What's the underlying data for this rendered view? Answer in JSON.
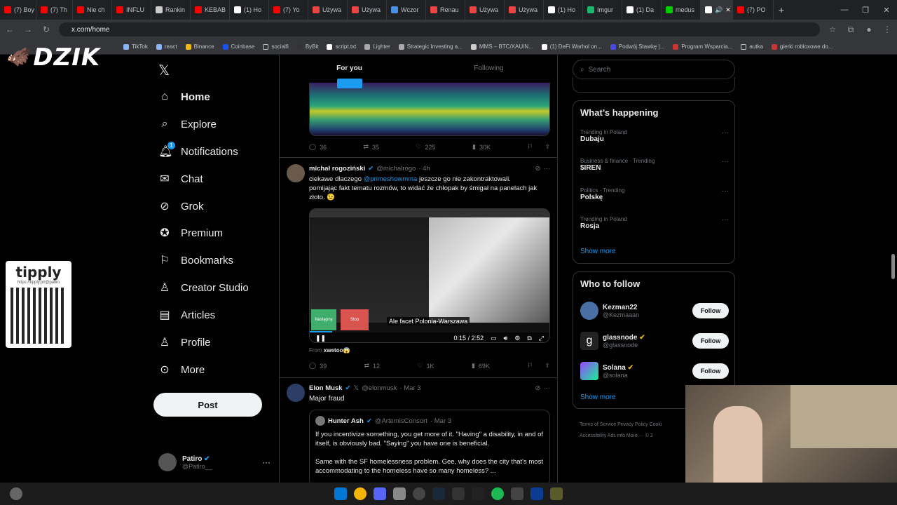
{
  "browser": {
    "tabs": [
      "(7) Boy",
      "(7) Th",
      "Nie ch",
      "INFLU",
      "Rankin",
      "KEBAB",
      "(1) Ho",
      "(7) Yo",
      "Używa",
      "Używa",
      "Wczor",
      "Renau",
      "Używa",
      "Używa",
      "(1) Ho",
      "Imgur",
      "(1) Da",
      "medus",
      "",
      "(7) PO"
    ],
    "url": "x.com/home",
    "bookmarks": [
      "TikTok",
      "react",
      "Binance",
      "Coinbase",
      "socialfi",
      "ByBit",
      "script.txt",
      "Lighter",
      "Strategic Investing a...",
      "MMS – BTC/XAU/N...",
      "(1) DeFi Warhol on...",
      "Podwój Stawkę |...",
      "Program Wsparcia...",
      "autka",
      "gierki robloxowe do..."
    ]
  },
  "overlay": {
    "brand": "DZIK",
    "tipply_title": "tipply",
    "tipply_url": "https://tipply.pl/@patiro"
  },
  "nav": {
    "items": [
      {
        "label": "Home",
        "icon": "home-icon"
      },
      {
        "label": "Explore",
        "icon": "search-icon"
      },
      {
        "label": "Notifications",
        "icon": "bell-icon"
      },
      {
        "label": "Chat",
        "icon": "mail-icon"
      },
      {
        "label": "Grok",
        "icon": "grok-icon"
      },
      {
        "label": "Premium",
        "icon": "premium-icon"
      },
      {
        "label": "Bookmarks",
        "icon": "bookmark-icon"
      },
      {
        "label": "Creator Studio",
        "icon": "creator-icon"
      },
      {
        "label": "Articles",
        "icon": "articles-icon"
      },
      {
        "label": "Profile",
        "icon": "person-icon"
      },
      {
        "label": "More",
        "icon": "more-icon"
      }
    ],
    "notif_badge": "1",
    "post_label": "Post",
    "user_name": "Patiro",
    "user_handle": "@Patiro__"
  },
  "feed": {
    "tabs": [
      "For you",
      "Following"
    ],
    "tweet0": {
      "replies": "36",
      "reposts": "35",
      "likes": "225",
      "views": "30K"
    },
    "tweet1": {
      "name": "michał rogoziński",
      "handle": "@michalrogo",
      "time": "· 4h",
      "line1_pre": "ciekawe dlaczego ",
      "mention": "@primeshowmma",
      "line1_post": " jeszcze go nie zakontraktowali.",
      "line2": "pomijając fakt tematu rozmów, to widać że chłopak by śmigał na panelach jak złoto. 😉",
      "caption": "Ale facet Polonia-Warszawa",
      "video_time": "0:15 / 2:52",
      "btn_green": "Następny",
      "btn_red": "Stop",
      "from_label": "From",
      "from_user": "xwetoo😱",
      "replies": "39",
      "reposts": "12",
      "likes": "1K",
      "views": "69K"
    },
    "tweet2": {
      "name": "Elon Musk",
      "handle": "@elonmusk",
      "time": "· Mar 3",
      "text": "Major fraud",
      "quote_name": "Hunter Ash",
      "quote_handle": "@ArtemisConsort",
      "quote_time": "· Mar 3",
      "quote_p1": "If you incentivize something, you get more of it. \"Having\" a disability, in and of itself, is obviously bad. \"Saying\" you have one is beneficial.",
      "quote_p2": "Same with the SF homelessness problem. Gee, why does the city that's most accommodating to the homeless have so many homeless? ..."
    }
  },
  "right": {
    "search_placeholder": "Search",
    "happening_title": "What’s happening",
    "trends": [
      {
        "meta": "Trending in Poland",
        "name": "Dubaju"
      },
      {
        "meta": "Business & finance · Trending",
        "name": "$IREN"
      },
      {
        "meta": "Politics · Trending",
        "name": "Polskę"
      },
      {
        "meta": "Trending in Poland",
        "name": "Rosja"
      }
    ],
    "show_more": "Show more",
    "wtf_title": "Who to follow",
    "follow": [
      {
        "name": "Kezman22",
        "handle": "@Kezmaaan"
      },
      {
        "name": "glassnode",
        "handle": "@glassnode"
      },
      {
        "name": "Solana",
        "handle": "@solana"
      }
    ],
    "follow_label": "Follow",
    "footer1": "Terms of Service   Privacy Policy   Cooki",
    "footer2": "Accessibility   Ads info   More ···  © 2"
  }
}
